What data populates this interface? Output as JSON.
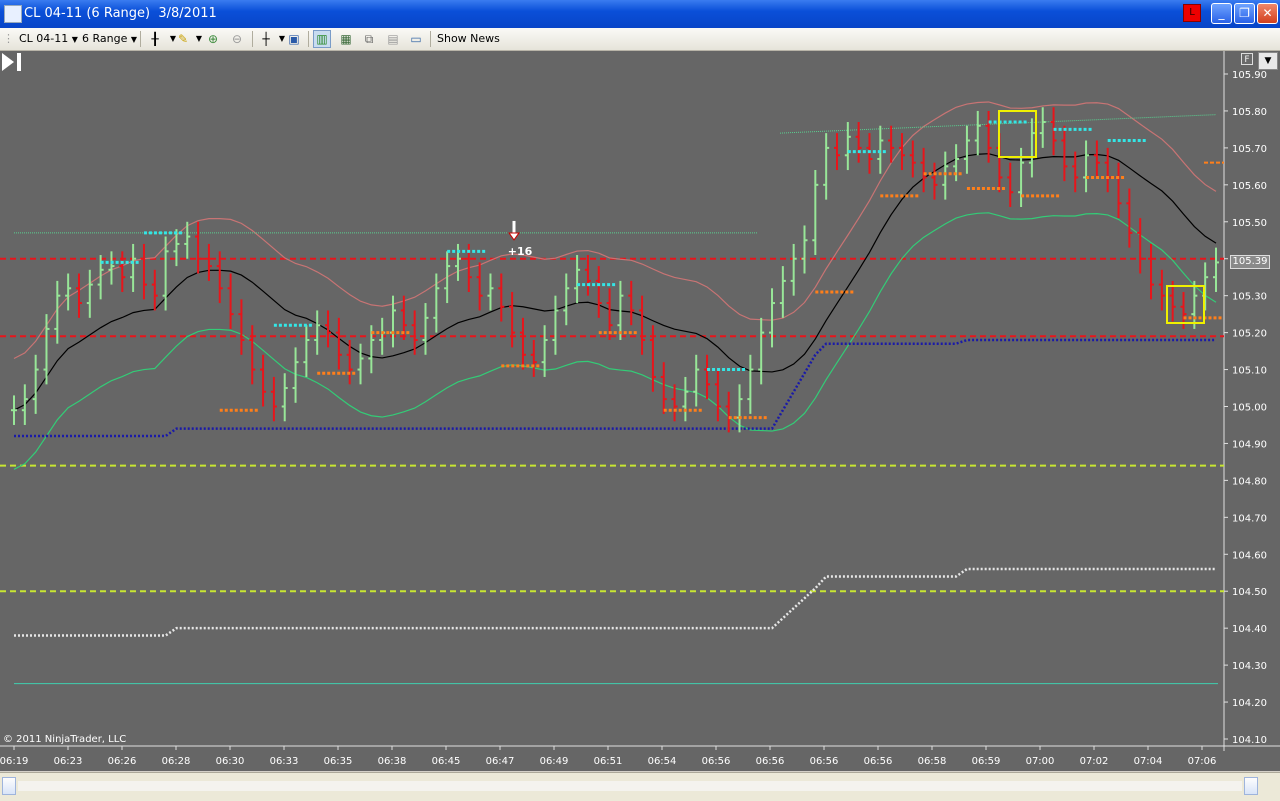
{
  "window": {
    "title": "CL 04-11 (6 Range)  3/8/2011",
    "alert_label": "L",
    "minimize_label": "_",
    "maximize_label": "❐",
    "close_label": "✕"
  },
  "toolbar": {
    "instrument": "CL 04-11",
    "interval": "6 Range",
    "show_news_label": "Show News",
    "icons": [
      "bar-type-icon",
      "draw-pencil-icon",
      "zoom-in-icon",
      "zoom-out-icon",
      "crosshair-icon",
      "data-box-icon",
      "chart-trader-icon",
      "strategies-icon",
      "indicators-icon",
      "properties-icon",
      "templates-icon"
    ]
  },
  "chart": {
    "copyright": "© 2011 NinjaTrader, LLC",
    "current_price_label": "105.39",
    "trade_marker_label": "+16",
    "format_label": "F",
    "colors": {
      "background": "#666666",
      "up_bar": "#98e698",
      "down_bar": "#e8151b",
      "sma": "#000000",
      "upper_band": "#c87474",
      "lower_band": "#33cc77",
      "resistance": "#e8151b",
      "support_yellow": "#c8e632",
      "cyan_marks": "#33e6e6",
      "orange_marks": "#ff7f1a",
      "trail_stop_blue": "#1a1aa8",
      "trail_stop_white": "#e6e6e6"
    }
  },
  "chart_data": {
    "type": "ohlc_range",
    "instrument": "CL 04-11",
    "interval": "6 Range",
    "date": "3/8/2011",
    "y_ticks": [
      "105.90",
      "105.80",
      "105.70",
      "105.60",
      "105.50",
      "105.40",
      "105.30",
      "105.20",
      "105.10",
      "105.00",
      "104.90",
      "104.80",
      "104.70",
      "104.60",
      "104.50",
      "104.40",
      "104.30",
      "104.20",
      "104.10"
    ],
    "x_ticks": [
      "06:19",
      "06:23",
      "06:26",
      "06:28",
      "06:30",
      "06:33",
      "06:35",
      "06:38",
      "06:45",
      "06:47",
      "06:49",
      "06:51",
      "06:54",
      "06:56",
      "06:56",
      "06:56",
      "06:56",
      "06:58",
      "06:59",
      "07:00",
      "07:02",
      "07:04",
      "07:06"
    ],
    "ylim": [
      104.1,
      105.9
    ],
    "current_price": 105.39,
    "horizontal_lines": [
      {
        "name": "red-dashed-upper",
        "price": 105.4
      },
      {
        "name": "red-dashed-lower",
        "price": 105.19
      },
      {
        "name": "yellow-dashed-upper",
        "price": 104.84
      },
      {
        "name": "yellow-dashed-lower",
        "price": 104.5
      }
    ],
    "trade_marker": {
      "label": "+16",
      "price": 105.44,
      "time": "06:47"
    },
    "close_path": [
      104.99,
      105.02,
      105.1,
      105.21,
      105.3,
      105.32,
      105.28,
      105.33,
      105.37,
      105.38,
      105.35,
      105.4,
      105.33,
      105.3,
      105.42,
      105.44,
      105.46,
      105.4,
      105.38,
      105.32,
      105.25,
      105.18,
      105.1,
      105.04,
      105.0,
      105.05,
      105.12,
      105.18,
      105.22,
      105.2,
      105.14,
      105.1,
      105.13,
      105.18,
      105.2,
      105.26,
      105.22,
      105.18,
      105.24,
      105.32,
      105.38,
      105.4,
      105.35,
      105.3,
      105.32,
      105.27,
      105.2,
      105.14,
      105.12,
      105.18,
      105.26,
      105.32,
      105.37,
      105.34,
      105.28,
      105.22,
      105.3,
      105.26,
      105.18,
      105.08,
      105.02,
      105.0,
      105.04,
      105.1,
      105.06,
      105.0,
      104.97,
      105.02,
      105.1,
      105.2,
      105.28,
      105.34,
      105.4,
      105.45,
      105.6,
      105.7,
      105.68,
      105.73,
      105.7,
      105.67,
      105.72,
      105.7,
      105.68,
      105.66,
      105.62,
      105.6,
      105.65,
      105.67,
      105.72,
      105.76,
      105.7,
      105.62,
      105.58,
      105.66,
      105.74,
      105.77,
      105.72,
      105.65,
      105.62,
      105.68,
      105.66,
      105.62,
      105.55,
      105.47,
      105.4,
      105.33,
      105.3,
      105.27,
      105.25,
      105.3,
      105.35,
      105.39
    ]
  }
}
